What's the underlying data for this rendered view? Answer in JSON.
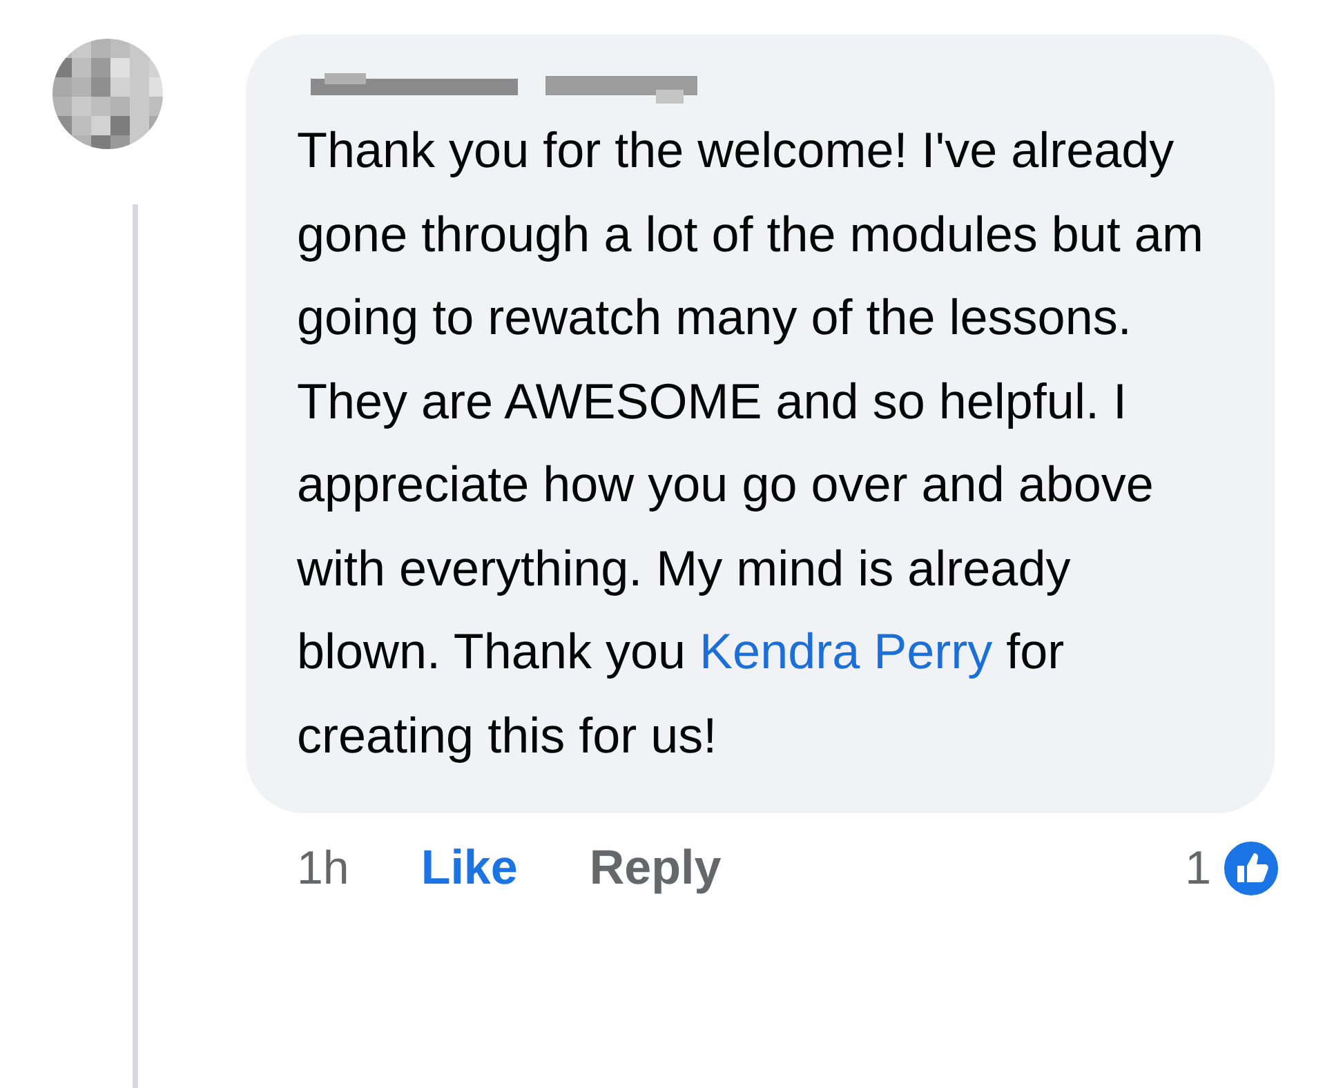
{
  "comment": {
    "message_before": "Thank you for the welcome! I've already gone through a lot of the modules but am going to rewatch many of the lessons. They are AWESOME and so helpful. I appreciate how you go over and above with everything. My mind is already blown. Thank you",
    "mention": "Kendra Perry",
    "message_after": "for creating this for us!"
  },
  "footer": {
    "time": "1h",
    "like": "Like",
    "reply": "Reply",
    "reaction_count": "1"
  }
}
